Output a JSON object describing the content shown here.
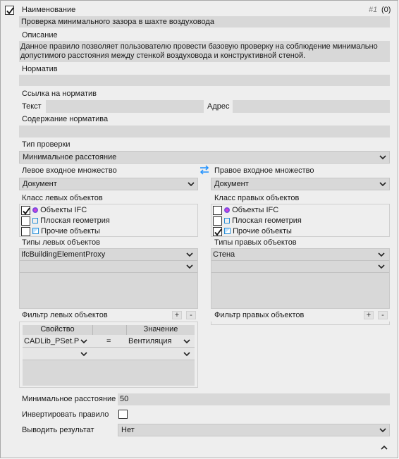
{
  "header": {
    "name_label": "Наименование",
    "counter_prefix": "#1",
    "counter_suffix": "(0)",
    "enabled": true
  },
  "name_value": "Проверка минимального зазора в шахте воздуховода",
  "description": {
    "label": "Описание",
    "value": "Данное правило позволяет пользователю провести базовую проверку на соблюдение минимально допустимого расстояния между стенкой воздуховода и конструктивной стеной."
  },
  "normative": {
    "label": "Норматив",
    "value": ""
  },
  "normative_link": {
    "label": "Ссылка на норматив",
    "text_label": "Текст",
    "text_value": "",
    "address_label": "Адрес",
    "address_value": ""
  },
  "normative_content": {
    "label": "Содержание норматива",
    "value": ""
  },
  "check_type": {
    "label": "Тип проверки",
    "value": "Минимальное расстояние"
  },
  "left": {
    "set_label": "Левое входное множество",
    "set_value": "Документ",
    "class_label": "Класс левых объектов",
    "classes": [
      {
        "label": "Объекты IFC",
        "checked": true,
        "icon": "ifc-icon"
      },
      {
        "label": "Плоская геометрия",
        "checked": false,
        "icon": "flat-geometry-icon"
      },
      {
        "label": "Прочие объекты",
        "checked": false,
        "icon": "other-objects-icon"
      }
    ],
    "types_label": "Типы левых объектов",
    "types": [
      "IfcBuildingElementProxy",
      ""
    ],
    "filter_label": "Фильтр левых объектов"
  },
  "right": {
    "set_label": "Правое входное множество",
    "set_value": "Документ",
    "class_label": "Класс правых объектов",
    "classes": [
      {
        "label": "Объекты IFC",
        "checked": false,
        "icon": "ifc-icon"
      },
      {
        "label": "Плоская геометрия",
        "checked": false,
        "icon": "flat-geometry-icon"
      },
      {
        "label": "Прочие объекты",
        "checked": true,
        "icon": "other-objects-icon"
      }
    ],
    "types_label": "Типы правых объектов",
    "types": [
      "Стена",
      ""
    ],
    "filter_label": "Фильтр правых объектов"
  },
  "filter_table": {
    "col_property": "Свойство",
    "col_value": "Значение",
    "rows": [
      {
        "property": "CADLib_PSet.P",
        "op": "=",
        "value": "Вентиляция"
      },
      {
        "property": "",
        "op": "",
        "value": ""
      }
    ]
  },
  "min_distance": {
    "label": "Минимальное расстояние",
    "value": "50"
  },
  "invert": {
    "label": "Инвертировать правило",
    "checked": false
  },
  "output": {
    "label": "Выводить результат",
    "value": "Нет"
  },
  "buttons": {
    "plus": "+",
    "minus": "-"
  },
  "colors": {
    "field_bg": "#d8d8d8",
    "panel_bg": "#eeeeee",
    "swap_icon": "#1e90ff",
    "highlight": "#cfd8e6"
  }
}
